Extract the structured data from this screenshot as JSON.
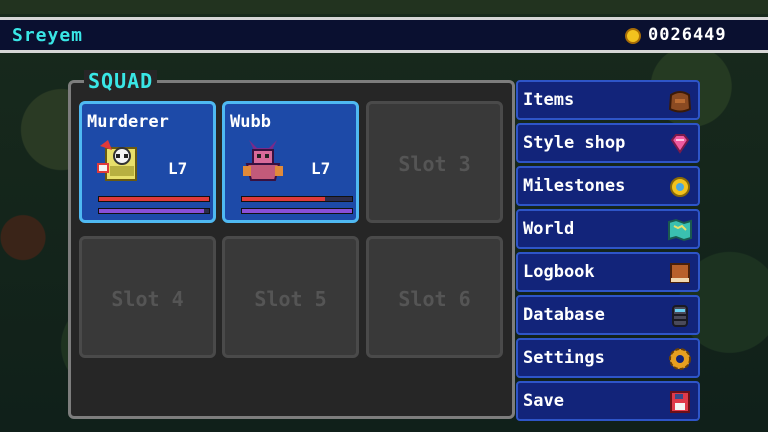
{
  "topbar": {
    "player_name": "Sreyem",
    "coins": "0026449"
  },
  "squad": {
    "title": "SQUAD",
    "slots": [
      {
        "name": "Murderer",
        "level": "L7",
        "hp": 1.0,
        "mp": 0.95
      },
      {
        "name": "Wubb",
        "level": "L7",
        "hp": 0.75,
        "mp": 1.0
      },
      {
        "label": "Slot 3"
      },
      {
        "label": "Slot 4"
      },
      {
        "label": "Slot 5"
      },
      {
        "label": "Slot 6"
      }
    ]
  },
  "menu": {
    "items": [
      {
        "label": "Items",
        "icon": "bag-icon"
      },
      {
        "label": "Style shop",
        "icon": "gem-icon"
      },
      {
        "label": "Milestones",
        "icon": "medal-icon"
      },
      {
        "label": "World",
        "icon": "map-icon"
      },
      {
        "label": "Logbook",
        "icon": "book-icon"
      },
      {
        "label": "Database",
        "icon": "database-icon"
      },
      {
        "label": "Settings",
        "icon": "gear-icon"
      },
      {
        "label": "Save",
        "icon": "floppy-disk-icon"
      }
    ]
  },
  "colors": {
    "accent": "#39e6e6",
    "slot_filled": "#1d4aa8",
    "menu_bg": "#12247a",
    "coin": "#f2c21e"
  }
}
